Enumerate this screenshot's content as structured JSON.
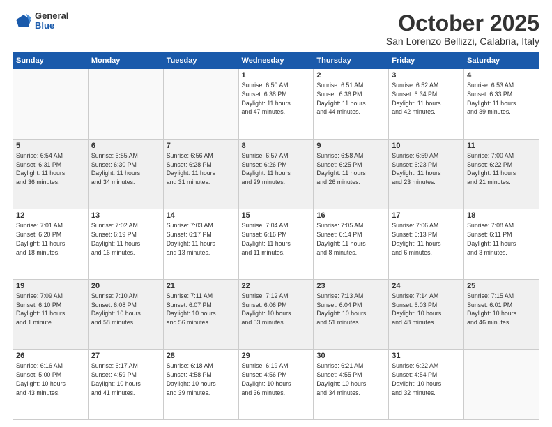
{
  "header": {
    "logo_general": "General",
    "logo_blue": "Blue",
    "title": "October 2025",
    "location": "San Lorenzo Bellizzi, Calabria, Italy"
  },
  "weekdays": [
    "Sunday",
    "Monday",
    "Tuesday",
    "Wednesday",
    "Thursday",
    "Friday",
    "Saturday"
  ],
  "weeks": [
    [
      {
        "day": "",
        "info": ""
      },
      {
        "day": "",
        "info": ""
      },
      {
        "day": "",
        "info": ""
      },
      {
        "day": "1",
        "info": "Sunrise: 6:50 AM\nSunset: 6:38 PM\nDaylight: 11 hours\nand 47 minutes."
      },
      {
        "day": "2",
        "info": "Sunrise: 6:51 AM\nSunset: 6:36 PM\nDaylight: 11 hours\nand 44 minutes."
      },
      {
        "day": "3",
        "info": "Sunrise: 6:52 AM\nSunset: 6:34 PM\nDaylight: 11 hours\nand 42 minutes."
      },
      {
        "day": "4",
        "info": "Sunrise: 6:53 AM\nSunset: 6:33 PM\nDaylight: 11 hours\nand 39 minutes."
      }
    ],
    [
      {
        "day": "5",
        "info": "Sunrise: 6:54 AM\nSunset: 6:31 PM\nDaylight: 11 hours\nand 36 minutes."
      },
      {
        "day": "6",
        "info": "Sunrise: 6:55 AM\nSunset: 6:30 PM\nDaylight: 11 hours\nand 34 minutes."
      },
      {
        "day": "7",
        "info": "Sunrise: 6:56 AM\nSunset: 6:28 PM\nDaylight: 11 hours\nand 31 minutes."
      },
      {
        "day": "8",
        "info": "Sunrise: 6:57 AM\nSunset: 6:26 PM\nDaylight: 11 hours\nand 29 minutes."
      },
      {
        "day": "9",
        "info": "Sunrise: 6:58 AM\nSunset: 6:25 PM\nDaylight: 11 hours\nand 26 minutes."
      },
      {
        "day": "10",
        "info": "Sunrise: 6:59 AM\nSunset: 6:23 PM\nDaylight: 11 hours\nand 23 minutes."
      },
      {
        "day": "11",
        "info": "Sunrise: 7:00 AM\nSunset: 6:22 PM\nDaylight: 11 hours\nand 21 minutes."
      }
    ],
    [
      {
        "day": "12",
        "info": "Sunrise: 7:01 AM\nSunset: 6:20 PM\nDaylight: 11 hours\nand 18 minutes."
      },
      {
        "day": "13",
        "info": "Sunrise: 7:02 AM\nSunset: 6:19 PM\nDaylight: 11 hours\nand 16 minutes."
      },
      {
        "day": "14",
        "info": "Sunrise: 7:03 AM\nSunset: 6:17 PM\nDaylight: 11 hours\nand 13 minutes."
      },
      {
        "day": "15",
        "info": "Sunrise: 7:04 AM\nSunset: 6:16 PM\nDaylight: 11 hours\nand 11 minutes."
      },
      {
        "day": "16",
        "info": "Sunrise: 7:05 AM\nSunset: 6:14 PM\nDaylight: 11 hours\nand 8 minutes."
      },
      {
        "day": "17",
        "info": "Sunrise: 7:06 AM\nSunset: 6:13 PM\nDaylight: 11 hours\nand 6 minutes."
      },
      {
        "day": "18",
        "info": "Sunrise: 7:08 AM\nSunset: 6:11 PM\nDaylight: 11 hours\nand 3 minutes."
      }
    ],
    [
      {
        "day": "19",
        "info": "Sunrise: 7:09 AM\nSunset: 6:10 PM\nDaylight: 11 hours\nand 1 minute."
      },
      {
        "day": "20",
        "info": "Sunrise: 7:10 AM\nSunset: 6:08 PM\nDaylight: 10 hours\nand 58 minutes."
      },
      {
        "day": "21",
        "info": "Sunrise: 7:11 AM\nSunset: 6:07 PM\nDaylight: 10 hours\nand 56 minutes."
      },
      {
        "day": "22",
        "info": "Sunrise: 7:12 AM\nSunset: 6:06 PM\nDaylight: 10 hours\nand 53 minutes."
      },
      {
        "day": "23",
        "info": "Sunrise: 7:13 AM\nSunset: 6:04 PM\nDaylight: 10 hours\nand 51 minutes."
      },
      {
        "day": "24",
        "info": "Sunrise: 7:14 AM\nSunset: 6:03 PM\nDaylight: 10 hours\nand 48 minutes."
      },
      {
        "day": "25",
        "info": "Sunrise: 7:15 AM\nSunset: 6:01 PM\nDaylight: 10 hours\nand 46 minutes."
      }
    ],
    [
      {
        "day": "26",
        "info": "Sunrise: 6:16 AM\nSunset: 5:00 PM\nDaylight: 10 hours\nand 43 minutes."
      },
      {
        "day": "27",
        "info": "Sunrise: 6:17 AM\nSunset: 4:59 PM\nDaylight: 10 hours\nand 41 minutes."
      },
      {
        "day": "28",
        "info": "Sunrise: 6:18 AM\nSunset: 4:58 PM\nDaylight: 10 hours\nand 39 minutes."
      },
      {
        "day": "29",
        "info": "Sunrise: 6:19 AM\nSunset: 4:56 PM\nDaylight: 10 hours\nand 36 minutes."
      },
      {
        "day": "30",
        "info": "Sunrise: 6:21 AM\nSunset: 4:55 PM\nDaylight: 10 hours\nand 34 minutes."
      },
      {
        "day": "31",
        "info": "Sunrise: 6:22 AM\nSunset: 4:54 PM\nDaylight: 10 hours\nand 32 minutes."
      },
      {
        "day": "",
        "info": ""
      }
    ]
  ]
}
